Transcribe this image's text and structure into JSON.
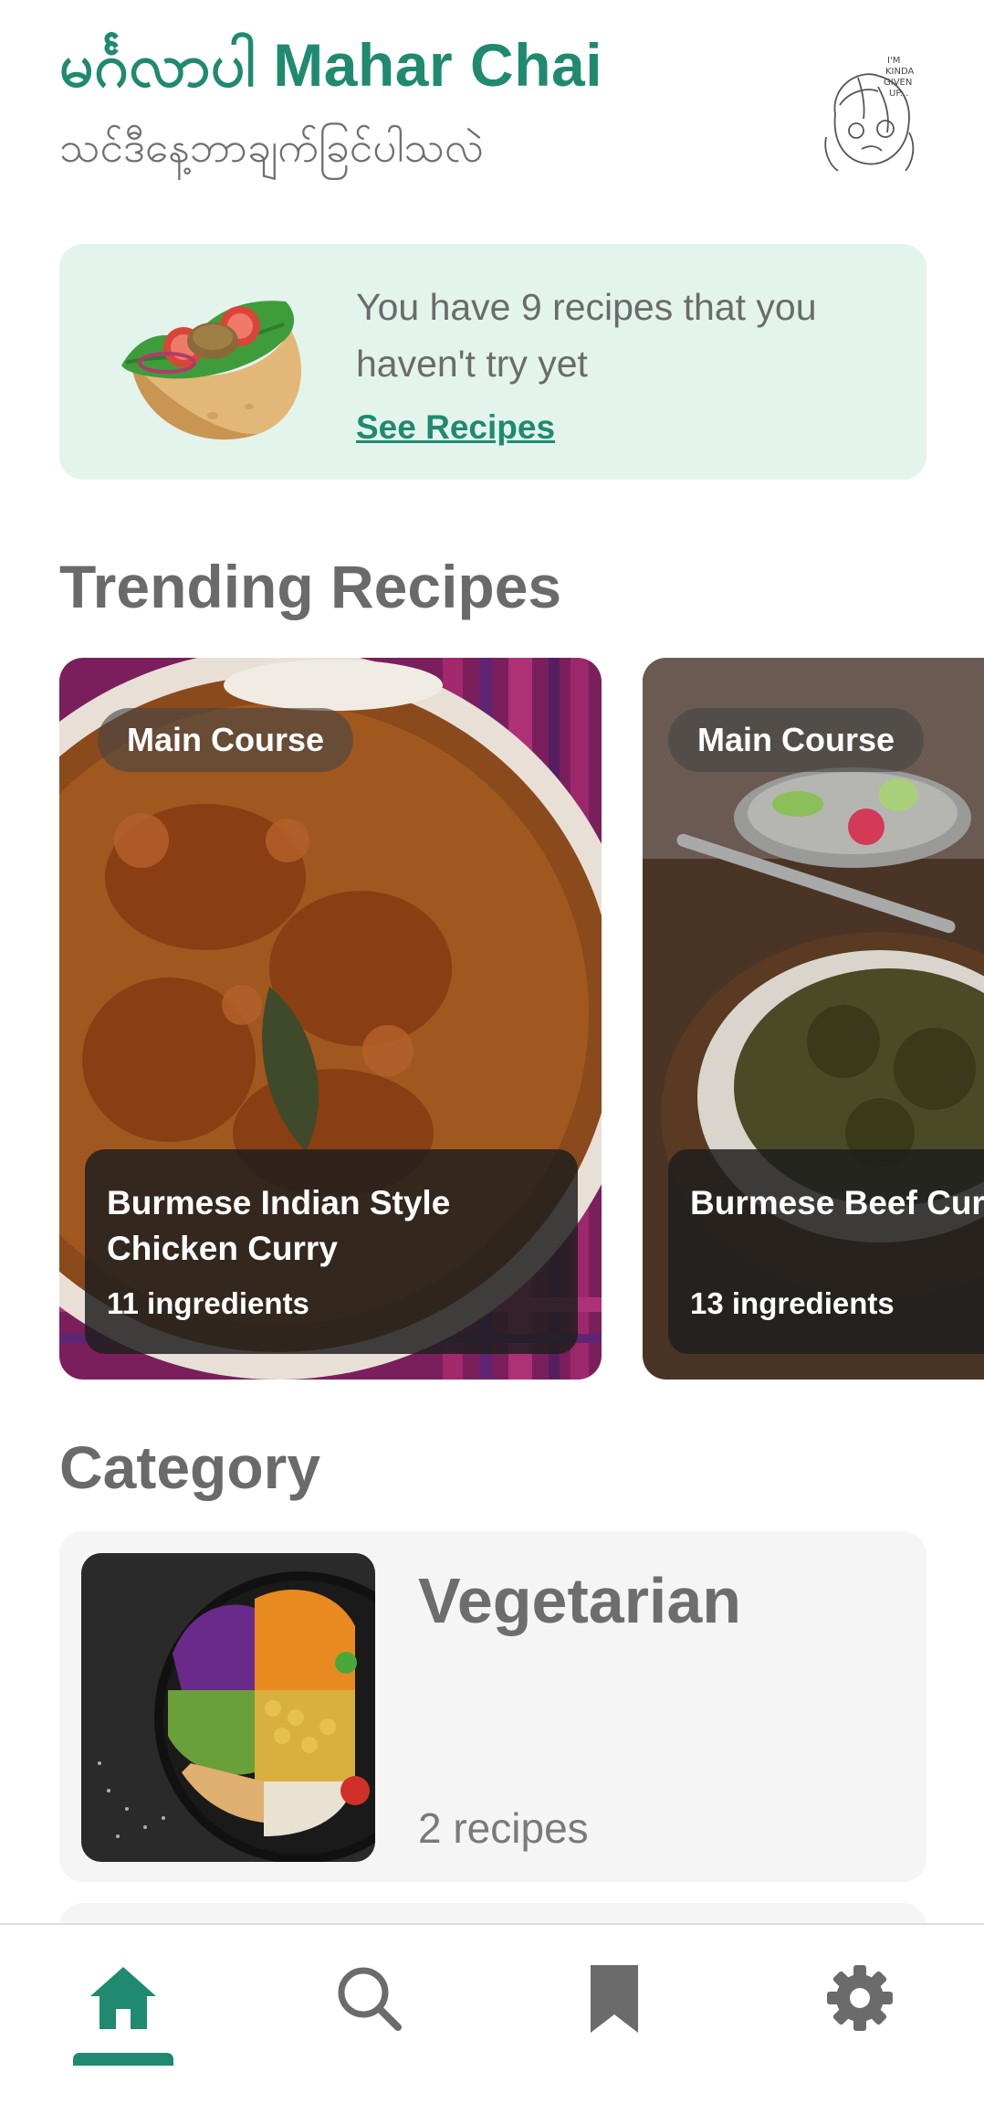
{
  "header": {
    "title": "မင်္ဂလာပါ Mahar Chai",
    "subtitle": "သင်ဒီနေ့ဘာချက်ခြင်ပါသလဲ",
    "avatar_text": "I'M KINDA GIVEN UP..."
  },
  "promo": {
    "message": "You have 9 recipes that you haven't try yet",
    "link_label": "See Recipes",
    "illustration_icon": "taco-icon"
  },
  "trending": {
    "title": "Trending Recipes",
    "cards": [
      {
        "tag": "Main Course",
        "name": "Burmese Indian Style Chicken Curry",
        "ingredients": "11 ingredients"
      },
      {
        "tag": "Main Course",
        "name": "Burmese Beef Curry",
        "ingredients": "13 ingredients"
      }
    ]
  },
  "category": {
    "title": "Category",
    "items": [
      {
        "name": "Vegetarian",
        "count": "2 recipes"
      }
    ]
  },
  "nav": {
    "items": [
      {
        "icon": "home-icon",
        "active": true
      },
      {
        "icon": "search-icon",
        "active": false
      },
      {
        "icon": "bookmark-icon",
        "active": false
      },
      {
        "icon": "gear-icon",
        "active": false
      }
    ],
    "colors": {
      "active": "#1f8a6f",
      "inactive": "#6b6b6b"
    }
  },
  "theme": {
    "accent": "#1f8a6f",
    "banner": "#e3f4ec"
  }
}
